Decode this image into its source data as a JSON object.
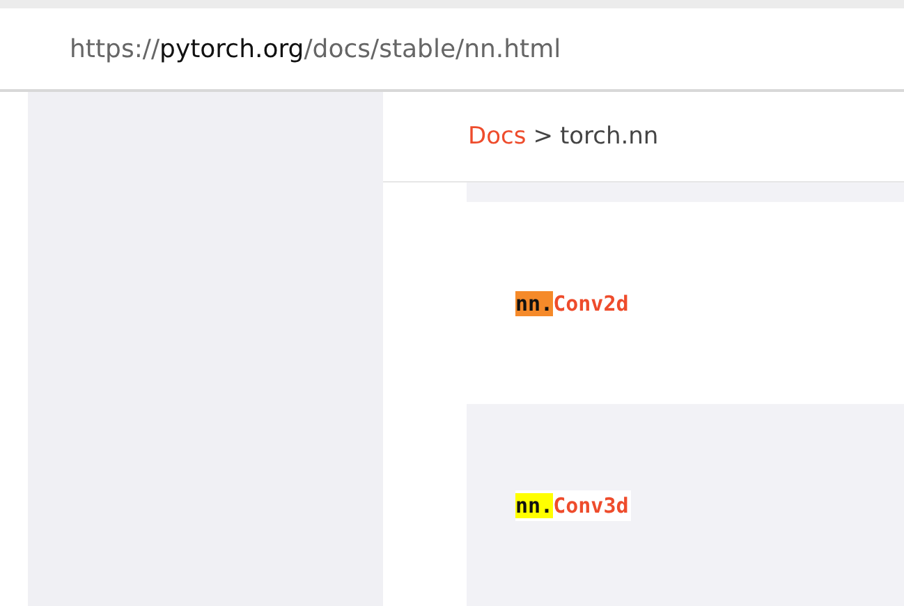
{
  "address_bar": {
    "scheme": "https://",
    "host": "pytorch.org",
    "path": "/docs/stable/nn.html"
  },
  "breadcrumb": {
    "link": "Docs",
    "separator": ">",
    "current": "torch.nn"
  },
  "results": [
    {
      "prefix": "nn.",
      "name": "Conv2d",
      "selected": true
    },
    {
      "prefix": "nn.",
      "name": "Conv3d",
      "selected": false
    }
  ]
}
